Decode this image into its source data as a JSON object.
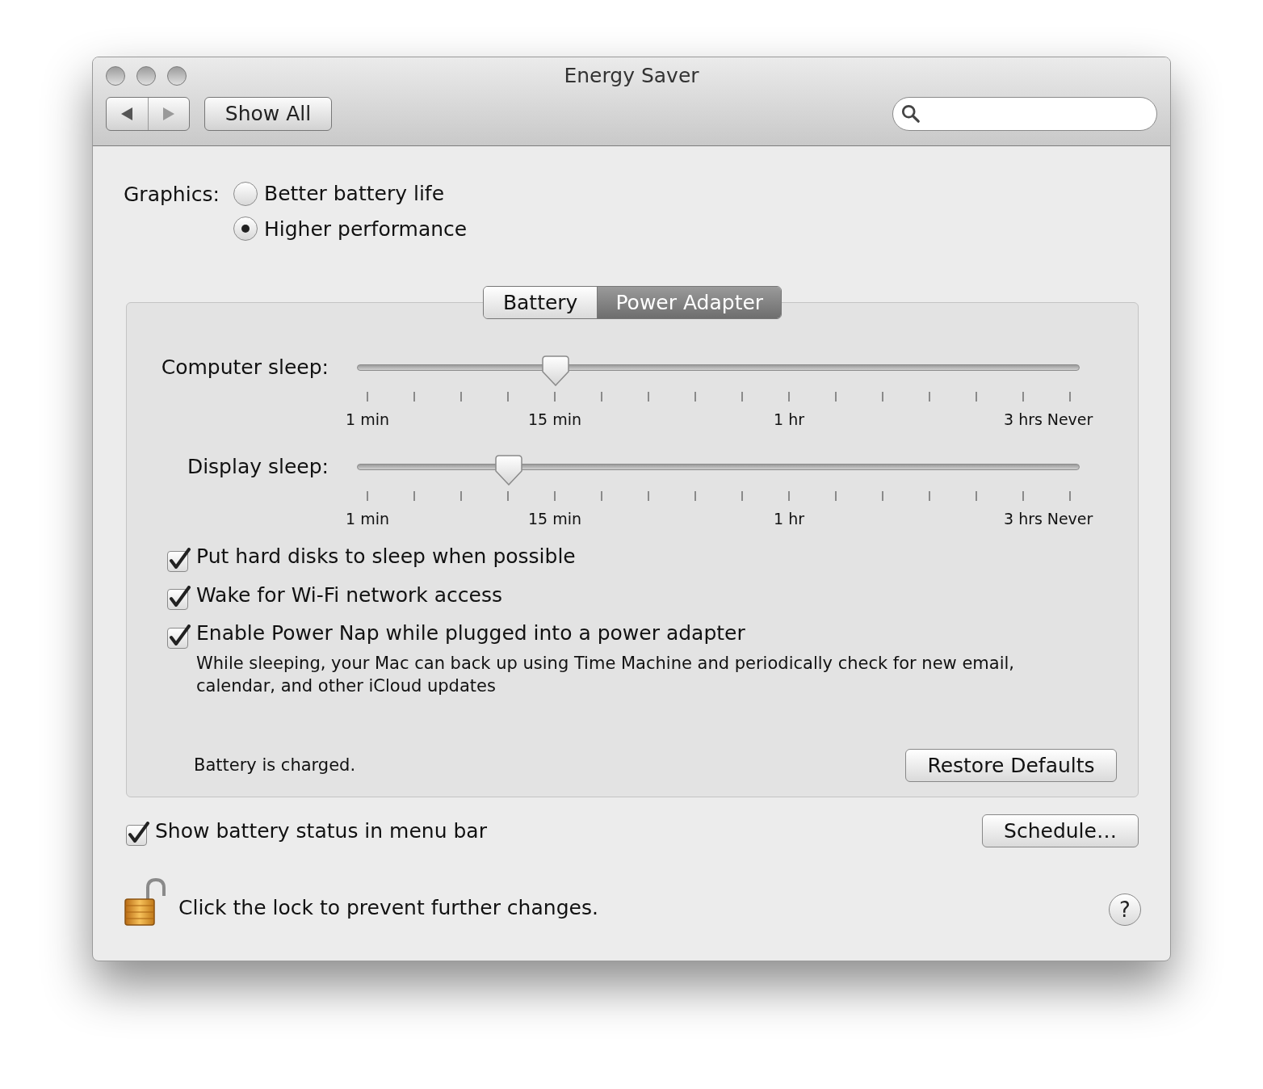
{
  "window": {
    "title": "Energy Saver"
  },
  "toolbar": {
    "show_all": "Show All"
  },
  "graphics": {
    "label": "Graphics:",
    "options": [
      {
        "label": "Better battery life",
        "selected": false
      },
      {
        "label": "Higher performance",
        "selected": true
      }
    ]
  },
  "tabs": [
    {
      "label": "Battery",
      "selected": false
    },
    {
      "label": "Power Adapter",
      "selected": true
    }
  ],
  "sliders": [
    {
      "label": "Computer sleep:",
      "level": 0.274,
      "tick_labels": [
        "1 min",
        "15 min",
        "1 hr",
        "3 hrs",
        "Never"
      ]
    },
    {
      "label": "Display sleep:",
      "level": 0.209,
      "tick_labels": [
        "1 min",
        "15 min",
        "1 hr",
        "3 hrs",
        "Never"
      ]
    }
  ],
  "options": [
    {
      "label": "Put hard disks to sleep when possible",
      "checked": true
    },
    {
      "label": "Wake for Wi-Fi network access",
      "checked": true
    },
    {
      "label": "Enable Power Nap while plugged into a power adapter",
      "checked": true,
      "description": "While sleeping, your Mac can back up using Time Machine and periodically check for new email, calendar, and other iCloud updates"
    }
  ],
  "status": "Battery is charged.",
  "restore_button": "Restore Defaults",
  "menu_bar_option": {
    "label": "Show battery status in menu bar",
    "checked": true
  },
  "schedule_button": "Schedule…",
  "lock_text": "Click the lock to prevent further changes.",
  "help_button": "?"
}
